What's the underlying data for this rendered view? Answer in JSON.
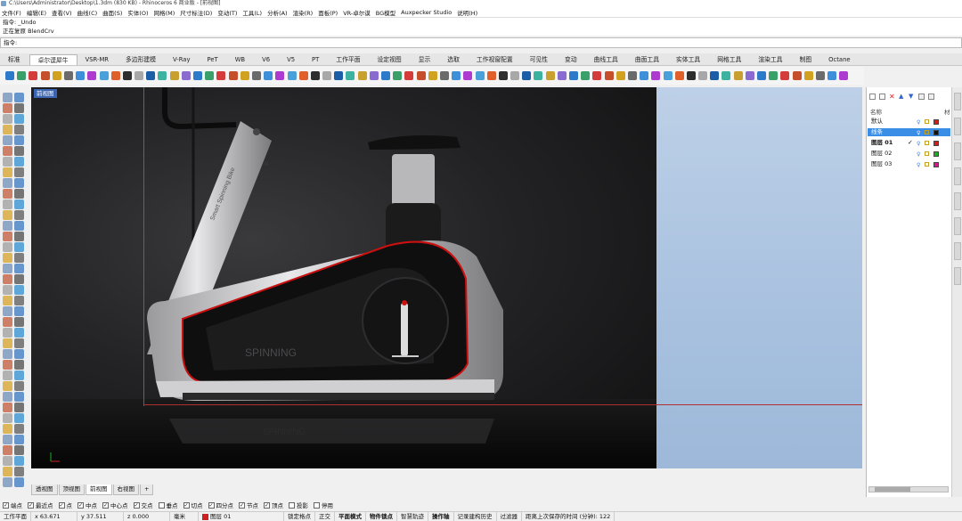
{
  "window": {
    "title": "C:\\Users\\Administrator\\Desktop\\1.3dm (830 KB) - Rhinoceros 6 商业版 - [前视图]"
  },
  "menu": [
    "文件(F)",
    "编辑(E)",
    "查看(V)",
    "曲线(C)",
    "曲面(S)",
    "实体(O)",
    "网格(M)",
    "尺寸标注(D)",
    "变动(T)",
    "工具(L)",
    "分析(A)",
    "渲染(R)",
    "面板(P)",
    "VR-卓尔谟",
    "BG模型",
    "Auxpecker Studio",
    "说明(H)"
  ],
  "command": {
    "history1": "指令: _Undo",
    "history2": "正在复原 BlendCrv",
    "prompt": "指令:"
  },
  "tabs": [
    "标准",
    "卓尔谟犀牛",
    "VSR-MR",
    "多边形建模",
    "V-Ray",
    "PeT",
    "WB",
    "V6",
    "V5",
    "PT",
    "工作平面",
    "设定视图",
    "显示",
    "选取",
    "工作视窗配置",
    "可见性",
    "变动",
    "曲线工具",
    "曲面工具",
    "实体工具",
    "网格工具",
    "渲染工具",
    "制图",
    "Octane"
  ],
  "active_tab": "卓尔谟犀牛",
  "viewport": {
    "label": "前视图",
    "brand_text": "SPINNING",
    "frame_text": "Smart Spinning Bike"
  },
  "layers": {
    "header": "名称",
    "header_right": "材",
    "rows": [
      {
        "name": "默认",
        "color": "#cc2020"
      },
      {
        "name": "线条",
        "color": "#111111"
      },
      {
        "name": "图层 01",
        "color": "#cc2020"
      },
      {
        "name": "图层 02",
        "color": "#22aa22"
      },
      {
        "name": "图层 03",
        "color": "#cc2080"
      }
    ]
  },
  "view_tabs": [
    "透视图",
    "顶视图",
    "前视图",
    "右视图",
    "+"
  ],
  "active_view_tab": "前视图",
  "osnaps": [
    {
      "label": "端点",
      "checked": true
    },
    {
      "label": "最近点",
      "checked": true
    },
    {
      "label": "点",
      "checked": true
    },
    {
      "label": "中点",
      "checked": true
    },
    {
      "label": "中心点",
      "checked": true
    },
    {
      "label": "交点",
      "checked": true
    },
    {
      "label": "垂点",
      "checked": false
    },
    {
      "label": "切点",
      "checked": true
    },
    {
      "label": "四分点",
      "checked": true
    },
    {
      "label": "节点",
      "checked": true
    },
    {
      "label": "顶点",
      "checked": true
    },
    {
      "label": "投影",
      "checked": false
    },
    {
      "label": "停用",
      "checked": false
    }
  ],
  "status": {
    "cplane": "工作平面",
    "x": "x 63.671",
    "y": "y 37.511",
    "z": "z 0.000",
    "unit": "毫米",
    "layer": "图层 01",
    "items": [
      "锁定格点",
      "正交",
      "平面模式",
      "物件锁点",
      "智慧轨迹",
      "操作轴",
      "记录建构历史",
      "过滤器"
    ],
    "message": "距离上次保存的时间 (分钟): 122"
  }
}
